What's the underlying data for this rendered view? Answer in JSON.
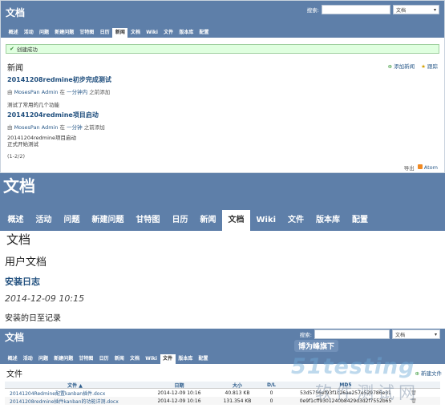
{
  "nav_tabs": [
    "概述",
    "活动",
    "问题",
    "新建问题",
    "甘特图",
    "日历",
    "新闻",
    "文档",
    "Wiki",
    "文件",
    "版本库",
    "配置"
  ],
  "search": {
    "label": "搜索:",
    "scope": "文档"
  },
  "panel1": {
    "title": "文档",
    "selected_tab": "新闻",
    "flash": "创建成功",
    "heading": "新闻",
    "add_news": "添加新闻",
    "subscribe": "跟踪",
    "items": [
      {
        "title": "20141208redmine初步完成测试",
        "by": "由",
        "author": "MosesPan Admin",
        "in_text": "在",
        "time": "一分钟内",
        "suffix": "之前添加",
        "desc": "测试了常用的几个功能"
      },
      {
        "title": "20141204redmine项目启动",
        "by": "由",
        "author": "MosesPan Admin",
        "in_text": "在",
        "time": "一分钟",
        "suffix": "之前添加",
        "desc": "20141204redmine项目启动\n正式开始测试"
      }
    ],
    "pagination": "(1-2/2)",
    "export": "导出",
    "atom": "Atom"
  },
  "panel2": {
    "title": "文档",
    "selected_tab": "文档",
    "heading": "文档",
    "category": "用户文档",
    "doc_title": "安装日志",
    "date": "2014-12-09 10:15",
    "desc": "安装的日至记录"
  },
  "panel3": {
    "title": "文档",
    "selected_tab": "文件",
    "heading": "文件",
    "new_file": "新建文件",
    "columns": [
      "文件 ▲",
      "日期",
      "大小",
      "D/L",
      "MD5"
    ],
    "rows": [
      {
        "file": "20141204Redmine配置kanban插件.docx",
        "date": "2014-12-09 10:16",
        "size": "40.813 KB",
        "dl": "0",
        "md5": "53d5756ef93f1c26ae257e529786e31"
      },
      {
        "file": "20141208redmine插件kanban的功能详测.docx",
        "date": "2014-12-09 10:16",
        "size": "131.354 KB",
        "dl": "0",
        "md5": "0e9f1cff9301240b8429d3d2f7552b65"
      }
    ]
  },
  "watermark": {
    "badge": "博为峰旗下",
    "logo": "51testing",
    "sub": "软件测试网"
  },
  "colors": {
    "header": "#5e7fa9",
    "link": "#2a5a8a",
    "flash_bg": "#dfffdf",
    "flash_border": "#9fcf9f"
  }
}
